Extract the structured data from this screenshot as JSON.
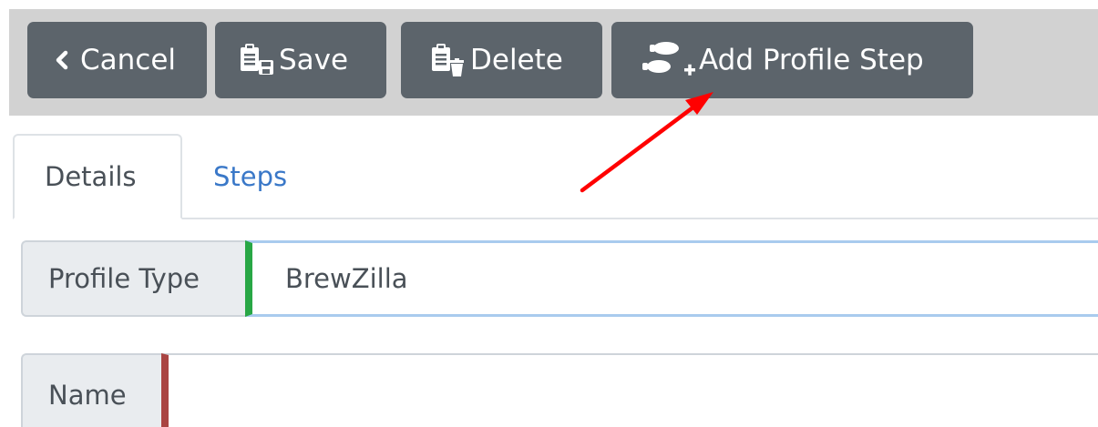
{
  "toolbar": {
    "cancel": {
      "icon": "chevron-left-icon",
      "label": "Cancel"
    },
    "save": {
      "icon": "clipboard-save-icon",
      "label": "Save"
    },
    "delete": {
      "icon": "clipboard-delete-icon",
      "label": "Delete"
    },
    "add_step": {
      "icon": "footsteps-add-icon",
      "label": "Add Profile Step"
    }
  },
  "tabs": [
    {
      "label": "Details",
      "active": true
    },
    {
      "label": "Steps",
      "active": false
    }
  ],
  "form": {
    "profile_type": {
      "label": "Profile Type",
      "value": "BrewZilla",
      "status_color": "#28a745"
    },
    "name": {
      "label": "Name",
      "value": "",
      "status_color": "#a94442"
    }
  },
  "colors": {
    "button_bg": "#5c646b",
    "toolbar_bg": "#d2d2d2",
    "link": "#3a78c8",
    "annotation_arrow": "#ff0000"
  }
}
